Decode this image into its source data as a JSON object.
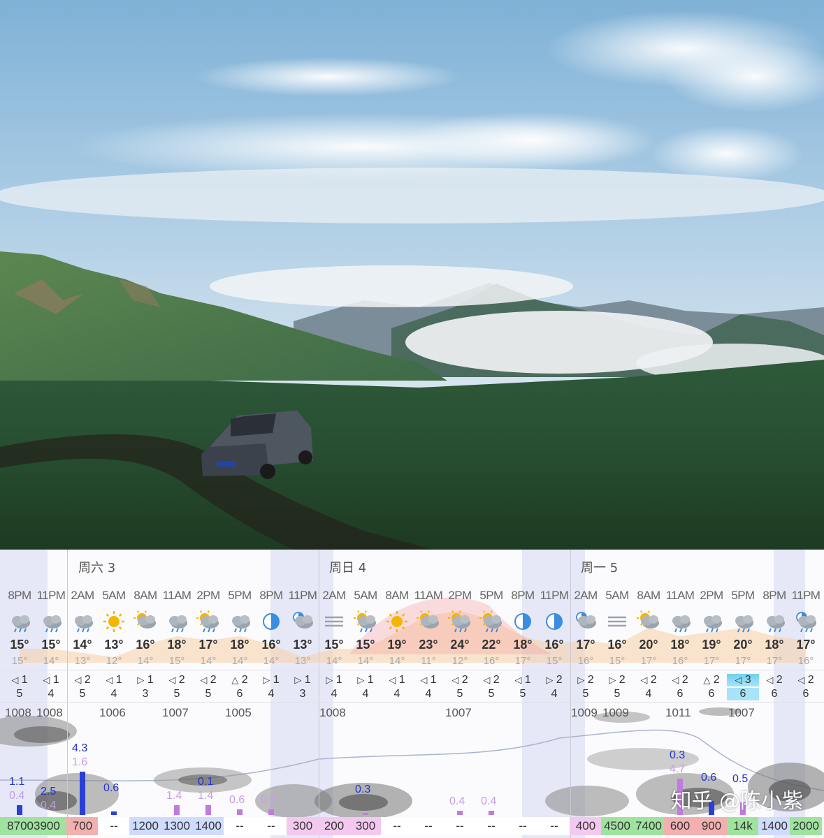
{
  "photo": {
    "subject": "landscape-photo"
  },
  "weather": {
    "days": [
      {
        "label": "周六 3"
      },
      {
        "label": "周日 4"
      },
      {
        "label": "周一 5"
      }
    ],
    "columns": [
      {
        "time": "8PM",
        "icon": "rain-cloud-icon",
        "temp": "15°",
        "feel": "15°",
        "wdir": "◁",
        "wf": "1",
        "ws": "5"
      },
      {
        "time": "11PM",
        "icon": "rain-cloud-icon",
        "temp": "15°",
        "feel": "14°",
        "wdir": "◁",
        "wf": "1",
        "ws": "4"
      },
      {
        "time": "2AM",
        "icon": "rain-cloud-icon",
        "temp": "14°",
        "feel": "13°",
        "wdir": "◁",
        "wf": "2",
        "ws": "5"
      },
      {
        "time": "5AM",
        "icon": "sun-icon",
        "temp": "13°",
        "feel": "12°",
        "wdir": "◁",
        "wf": "1",
        "ws": "4"
      },
      {
        "time": "8AM",
        "icon": "sun-cloud-icon",
        "temp": "16°",
        "feel": "14°",
        "wdir": "▷",
        "wf": "1",
        "ws": "3"
      },
      {
        "time": "11AM",
        "icon": "rain-cloud-icon",
        "temp": "18°",
        "feel": "15°",
        "wdir": "◁",
        "wf": "2",
        "ws": "5"
      },
      {
        "time": "2PM",
        "icon": "sun-rain-icon",
        "temp": "17°",
        "feel": "14°",
        "wdir": "◁",
        "wf": "2",
        "ws": "5"
      },
      {
        "time": "5PM",
        "icon": "rain-cloud-icon",
        "temp": "18°",
        "feel": "14°",
        "wdir": "△",
        "wf": "2",
        "ws": "6"
      },
      {
        "time": "8PM",
        "icon": "moon-half-icon",
        "temp": "16°",
        "feel": "14°",
        "wdir": "▷",
        "wf": "1",
        "ws": "4"
      },
      {
        "time": "11PM",
        "icon": "moon-cloud-icon",
        "temp": "13°",
        "feel": "13°",
        "wdir": "▷",
        "wf": "1",
        "ws": "3"
      },
      {
        "time": "2AM",
        "icon": "fog-icon",
        "temp": "15°",
        "feel": "14°",
        "wdir": "▷",
        "wf": "1",
        "ws": "4"
      },
      {
        "time": "5AM",
        "icon": "sun-rain-icon",
        "temp": "15°",
        "feel": "14°",
        "wdir": "▷",
        "wf": "1",
        "ws": "4"
      },
      {
        "time": "8AM",
        "icon": "sun-icon",
        "temp": "19°",
        "feel": "14°",
        "wdir": "◁",
        "wf": "1",
        "ws": "4"
      },
      {
        "time": "11AM",
        "icon": "sun-cloud-icon",
        "temp": "23°",
        "feel": "11°",
        "wdir": "◁",
        "wf": "1",
        "ws": "4"
      },
      {
        "time": "2PM",
        "icon": "sun-rain-icon",
        "temp": "24°",
        "feel": "12°",
        "wdir": "◁",
        "wf": "2",
        "ws": "5"
      },
      {
        "time": "5PM",
        "icon": "sun-rain-icon",
        "temp": "22°",
        "feel": "16°",
        "wdir": "◁",
        "wf": "2",
        "ws": "5"
      },
      {
        "time": "8PM",
        "icon": "moon-half-icon",
        "temp": "18°",
        "feel": "17°",
        "wdir": "◁",
        "wf": "1",
        "ws": "5"
      },
      {
        "time": "11PM",
        "icon": "moon-half-icon",
        "temp": "16°",
        "feel": "15°",
        "wdir": "▷",
        "wf": "2",
        "ws": "4"
      },
      {
        "time": "2AM",
        "icon": "moon-cloud-icon",
        "temp": "17°",
        "feel": "16°",
        "wdir": "▷",
        "wf": "2",
        "ws": "5"
      },
      {
        "time": "5AM",
        "icon": "fog-icon",
        "temp": "16°",
        "feel": "15°",
        "wdir": "▷",
        "wf": "2",
        "ws": "5"
      },
      {
        "time": "8AM",
        "icon": "sun-cloud-icon",
        "temp": "20°",
        "feel": "17°",
        "wdir": "◁",
        "wf": "2",
        "ws": "4"
      },
      {
        "time": "11AM",
        "icon": "rain-cloud-icon",
        "temp": "18°",
        "feel": "16°",
        "wdir": "◁",
        "wf": "2",
        "ws": "6"
      },
      {
        "time": "2PM",
        "icon": "rain-cloud-icon",
        "temp": "19°",
        "feel": "17°",
        "wdir": "△",
        "wf": "2",
        "ws": "6"
      },
      {
        "time": "5PM",
        "icon": "rain-cloud-icon",
        "temp": "20°",
        "feel": "17°",
        "wdir": "◁",
        "wf": "3",
        "ws": "6"
      },
      {
        "time": "8PM",
        "icon": "rain-cloud-icon",
        "temp": "18°",
        "feel": "17°",
        "wdir": "◁",
        "wf": "2",
        "ws": "6"
      },
      {
        "time": "11PM",
        "icon": "moon-rain-icon",
        "temp": "17°",
        "feel": "16°",
        "wdir": "◁",
        "wf": "2",
        "ws": "6"
      }
    ],
    "pressure": [
      {
        "col": 0,
        "text": "1008"
      },
      {
        "col": 1,
        "text": "1008"
      },
      {
        "col": 3,
        "text": "1006"
      },
      {
        "col": 5,
        "text": "1007"
      },
      {
        "col": 7,
        "text": "1005"
      },
      {
        "col": 10,
        "text": "1008"
      },
      {
        "col": 14,
        "text": "1007"
      },
      {
        "col": 18,
        "text": "1009"
      },
      {
        "col": 19,
        "text": "1009"
      },
      {
        "col": 21,
        "text": "1011"
      },
      {
        "col": 23,
        "text": "1007"
      }
    ],
    "rain": [
      {
        "col": 0,
        "blue": "1.1",
        "purple": "0.4",
        "bh": 14
      },
      {
        "col": 1,
        "blue": "2.5",
        "purple": "0.4",
        "bh": 0
      },
      {
        "col": 2,
        "blue": "4.3",
        "purple": "1.6",
        "bh": 62
      },
      {
        "col": 3,
        "blue": "0.6",
        "purple": "",
        "bh": 5
      },
      {
        "col": 5,
        "blue": "",
        "purple": "1.4",
        "bh": 14
      },
      {
        "col": 6,
        "blue": "0.1",
        "purple": "1.4",
        "bh": 14
      },
      {
        "col": 7,
        "blue": "",
        "purple": "0.6",
        "bh": 8
      },
      {
        "col": 8,
        "blue": "",
        "purple": "0.6",
        "bh": 8
      },
      {
        "col": 11,
        "blue": "0.3",
        "purple": "",
        "bh": 3
      },
      {
        "col": 14,
        "blue": "",
        "purple": "0.4",
        "bh": 6
      },
      {
        "col": 15,
        "blue": "",
        "purple": "0.4",
        "bh": 6
      },
      {
        "col": 21,
        "blue": "0.3",
        "purple": "4.7",
        "bh": 52
      },
      {
        "col": 22,
        "blue": "0.6",
        "purple": "",
        "bh": 20
      },
      {
        "col": 23,
        "blue": "0.5",
        "purple": "",
        "bh": 18
      }
    ],
    "visibility": [
      "87003900",
      "700",
      "--",
      "1200",
      "1300",
      "1400",
      "--",
      "--",
      "300",
      "200",
      "300",
      "--",
      "--",
      "--",
      "--",
      "--",
      "--",
      "400",
      "4500",
      "7400",
      "600",
      "900",
      "14k",
      "1400",
      "2000"
    ],
    "watermark": "知乎 @陈小紫"
  }
}
